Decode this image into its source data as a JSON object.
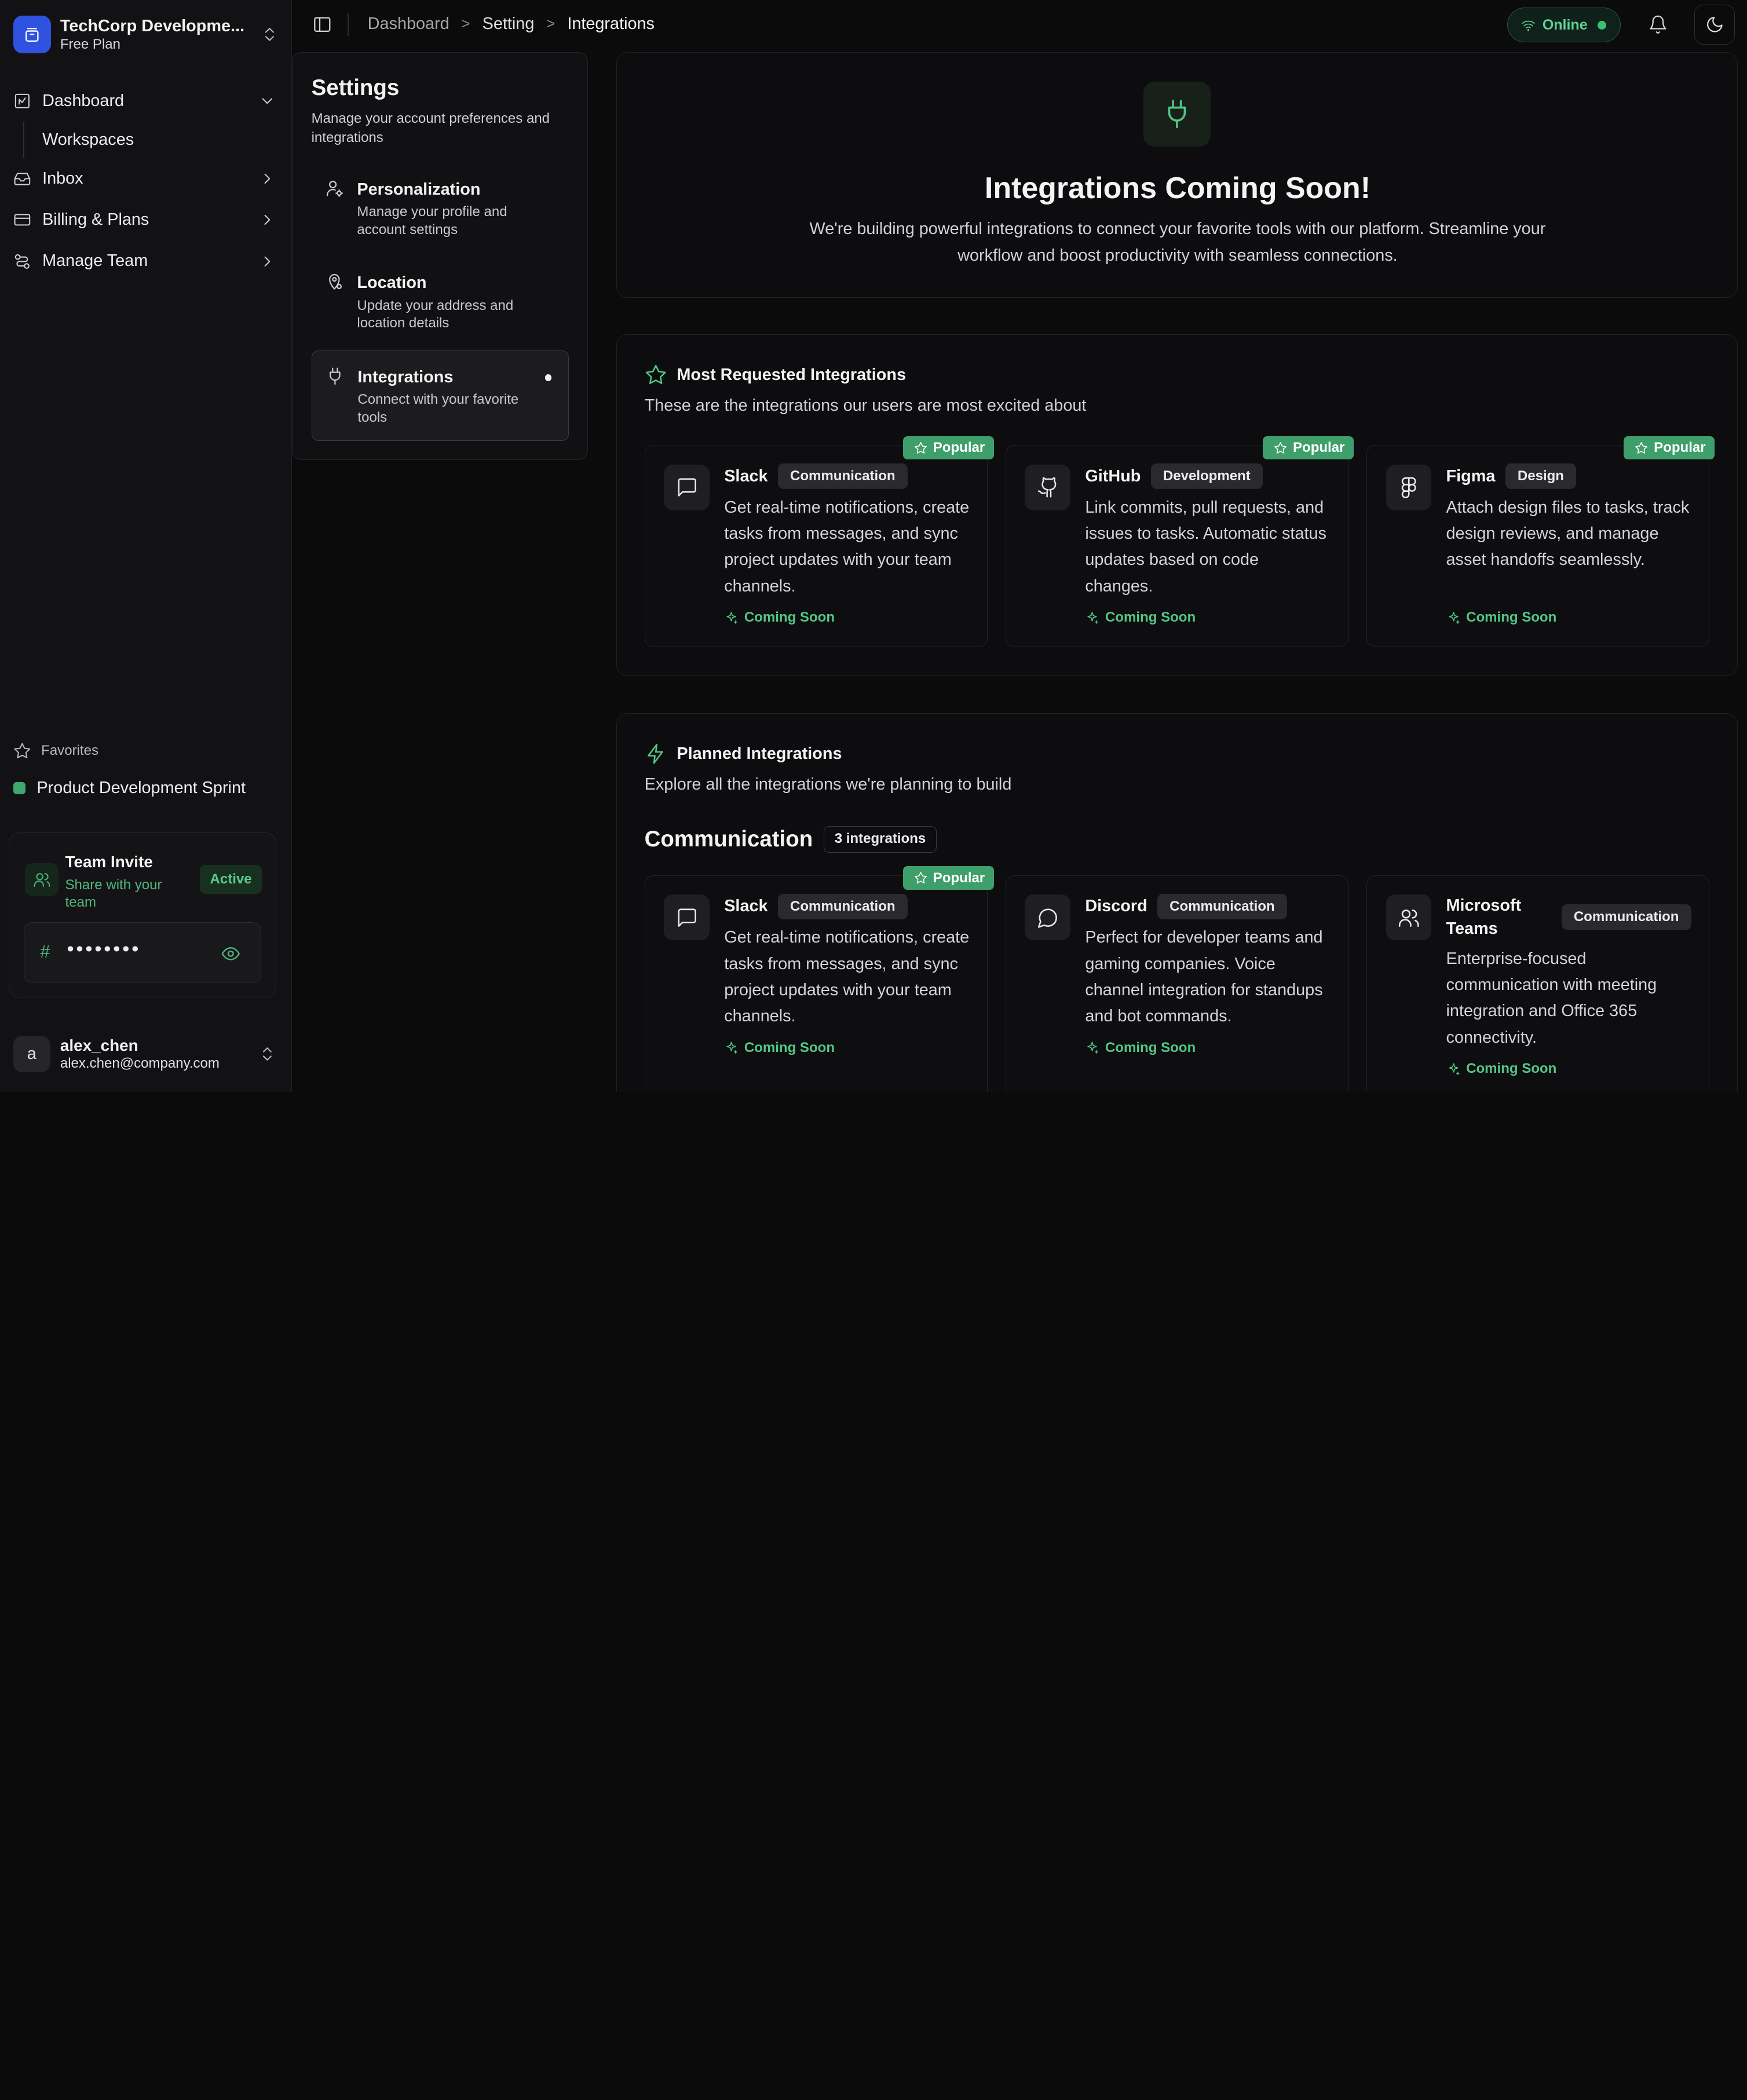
{
  "workspace": {
    "name": "TechCorp Developme...",
    "plan": "Free Plan"
  },
  "nav": {
    "dashboard": "Dashboard",
    "workspaces": "Workspaces",
    "inbox": "Inbox",
    "billing": "Billing & Plans",
    "team": "Manage Team"
  },
  "favorites": {
    "heading": "Favorites",
    "item": "Product Development Sprint"
  },
  "invite": {
    "title": "Team Invite",
    "subtitle": "Share with your team",
    "badge": "Active",
    "hash": "#",
    "password": "••••••••"
  },
  "user": {
    "initial": "a",
    "name": "alex_chen",
    "email": "alex.chen@company.com"
  },
  "breadcrumb": {
    "home": "Dashboard",
    "parent": "Setting",
    "current": "Integrations",
    "sep": ">"
  },
  "status": {
    "label": "Online"
  },
  "settings": {
    "title": "Settings",
    "description": "Manage your account preferences and integrations",
    "items": [
      {
        "title": "Personalization",
        "subtitle": "Manage your profile and account settings"
      },
      {
        "title": "Location",
        "subtitle": "Update your address and location details"
      },
      {
        "title": "Integrations",
        "subtitle": "Connect with your favorite tools"
      }
    ]
  },
  "hero": {
    "title": "Integrations Coming Soon!",
    "subtitle": "We're building powerful integrations to connect your favorite tools with our platform. Streamline your workflow and boost productivity with seamless connections."
  },
  "most_requested": {
    "title": "Most Requested Integrations",
    "subtitle": "These are the integrations our users are most excited about",
    "cards": [
      {
        "name": "Slack",
        "category": "Communication",
        "description": "Get real-time notifications, create tasks from messages, and sync project updates with your team channels.",
        "status": "Coming Soon",
        "badge": "Popular",
        "icon": "message-square-icon"
      },
      {
        "name": "GitHub",
        "category": "Development",
        "description": "Link commits, pull requests, and issues to tasks. Automatic status updates based on code changes.",
        "status": "Coming Soon",
        "badge": "Popular",
        "icon": "github-icon"
      },
      {
        "name": "Figma",
        "category": "Design",
        "description": "Attach design files to tasks, track design reviews, and manage asset handoffs seamlessly.",
        "status": "Coming Soon",
        "badge": "Popular",
        "icon": "figma-icon"
      }
    ]
  },
  "planned": {
    "title": "Planned Integrations",
    "subtitle": "Explore all the integrations we're planning to build",
    "category": "Communication",
    "category_count": "3 integrations",
    "cards": [
      {
        "name": "Slack",
        "category": "Communication",
        "description": "Get real-time notifications, create tasks from messages, and sync project updates with your team channels.",
        "status": "Coming Soon",
        "badge": "Popular",
        "icon": "message-square-icon"
      },
      {
        "name": "Discord",
        "category": "Communication",
        "description": "Perfect for developer teams and gaming companies. Voice channel integration for standups and bot commands.",
        "status": "Coming Soon",
        "icon": "message-circle-icon"
      },
      {
        "name": "Microsoft Teams",
        "category": "Communication",
        "description": "Enterprise-focused communication with meeting integration and Office 365 connectivity.",
        "status": "Coming Soon",
        "icon": "users-icon"
      }
    ]
  },
  "colors": {
    "accent": "#52c785",
    "popular": "#3e9f6b",
    "brand": "#2f52e0",
    "background": "#0b0b0c"
  }
}
